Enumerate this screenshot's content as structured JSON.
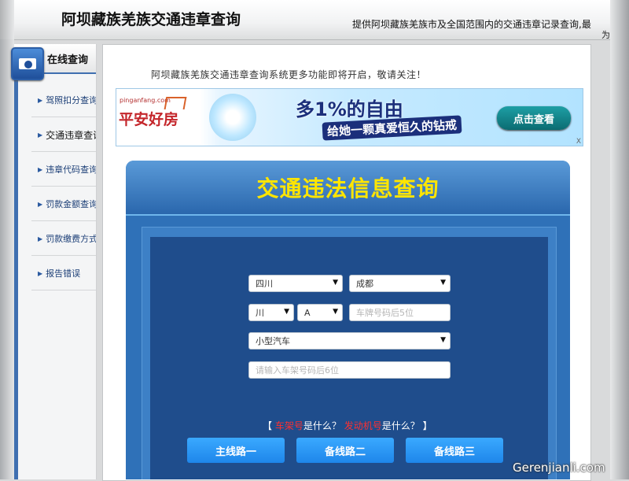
{
  "header": {
    "title": "阿坝藏族羌族交通违章查询",
    "tagline": "提供阿坝藏族羌族市及全国范围内的交通违章记录查询,最",
    "tagline_cont": "为"
  },
  "sidebar": {
    "title": "在线查询",
    "items": [
      {
        "label": "驾照扣分查询"
      },
      {
        "label": "交通违章查询"
      },
      {
        "label": "违章代码查询"
      },
      {
        "label": "罚款金额查询"
      },
      {
        "label": "罚款缴费方式"
      },
      {
        "label": "报告错误"
      }
    ]
  },
  "main": {
    "notice": "阿坝藏族羌族交通违章查询系统更多功能即将开启，敬请关注！"
  },
  "ad": {
    "brand_url": "pinganfang.com",
    "brand": "平安好房",
    "slogan1": "多1%的自由",
    "slogan2": "给她一颗真爱恒久的钻戒",
    "cta": "点击查看",
    "close_mark": "X"
  },
  "query": {
    "title": "交通违法信息查询",
    "province": "四川",
    "city": "成都",
    "plate_prefix": "川",
    "plate_letter": "A",
    "plate_placeholder": "车牌号码后5位",
    "vehicle_type": "小型汽车",
    "frame_placeholder": "请输入车架号码后6位",
    "help_open": "【",
    "help_term1": "车架号",
    "help_q1": "是什么？",
    "help_term2": "发动机号",
    "help_q2": "是什么？",
    "help_close": "】",
    "routes": [
      "主线路一",
      "备线路二",
      "备线路三"
    ]
  },
  "watermark": "Gerenjianli.com"
}
